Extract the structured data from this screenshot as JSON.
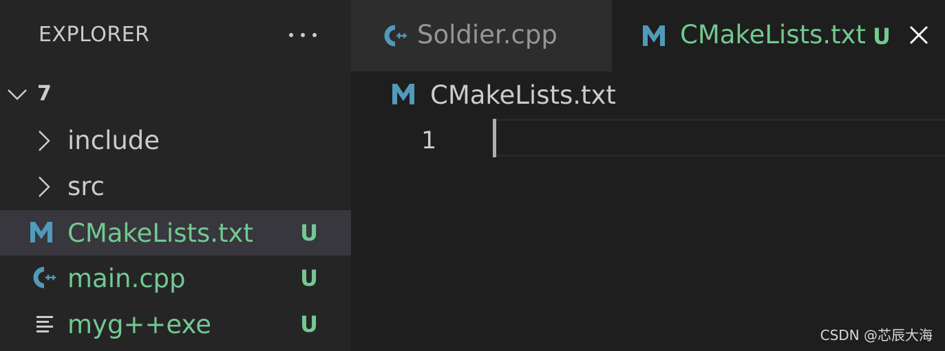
{
  "explorer": {
    "title": "EXPLORER",
    "more_icon": "more-horizontal-icon"
  },
  "tree": {
    "root": {
      "label": "7",
      "icon": "chevron-down-icon"
    },
    "items": [
      {
        "label": "include",
        "icon": "chevron-right-icon",
        "badge": "",
        "color": "#cccccc"
      },
      {
        "label": "src",
        "icon": "chevron-right-icon",
        "badge": "",
        "color": "#cccccc"
      },
      {
        "label": "CMakeLists.txt",
        "icon": "cmake-m-icon",
        "badge": "U",
        "color": "#73c991",
        "selected": true
      },
      {
        "label": "main.cpp",
        "icon": "cpp-file-icon",
        "badge": "U",
        "color": "#73c991"
      },
      {
        "label": "myg++exe",
        "icon": "text-lines-icon",
        "badge": "U",
        "color": "#73c991"
      }
    ]
  },
  "tabs": [
    {
      "label": "Soldier.cpp",
      "icon": "cpp-file-icon",
      "active": false
    },
    {
      "label": "CMakeLists.txt",
      "icon": "cmake-m-icon",
      "badge": "U",
      "close_icon": "close-icon",
      "active": true
    }
  ],
  "breadcrumb": {
    "label": "CMakeLists.txt",
    "icon": "cmake-m-icon"
  },
  "editor": {
    "line_number": "1"
  },
  "watermark": "CSDN @芯辰大海",
  "colors": {
    "untracked_green": "#73c991",
    "file_icon_blue": "#519aba",
    "sidebar_bg": "#252526",
    "editor_bg": "#1e1e1e",
    "selected_row_bg": "#37373d"
  }
}
